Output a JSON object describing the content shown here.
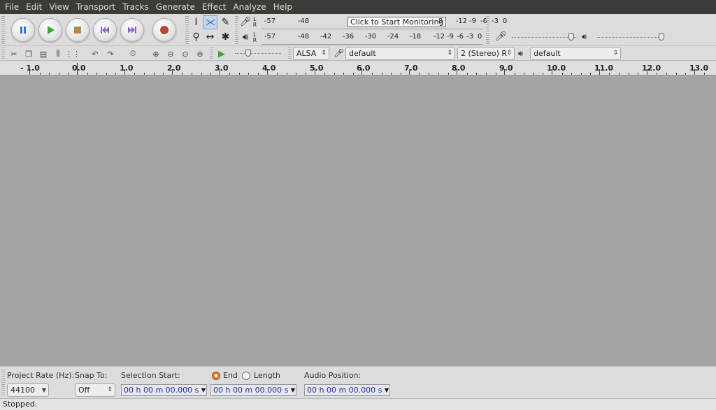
{
  "menu": [
    "File",
    "Edit",
    "View",
    "Transport",
    "Tracks",
    "Generate",
    "Effect",
    "Analyze",
    "Help"
  ],
  "transport": {
    "buttons": [
      {
        "name": "pause-button",
        "icon": "pause-icon",
        "color": "#3b6fd0"
      },
      {
        "name": "play-button",
        "icon": "play-icon",
        "color": "#3fa53a"
      },
      {
        "name": "stop-button",
        "icon": "stop-icon",
        "color": "#b58552"
      },
      {
        "name": "skip-to-start-button",
        "icon": "skip-start-icon",
        "color": "#8a63c5"
      },
      {
        "name": "skip-to-end-button",
        "icon": "skip-end-icon",
        "color": "#8a63c5"
      },
      {
        "name": "record-button",
        "icon": "record-icon",
        "color": "#b5483a"
      }
    ]
  },
  "meters": {
    "record_ticks": [
      "-57",
      "-48",
      "8",
      "-12",
      "-9",
      "-6",
      "-3",
      "0"
    ],
    "playback_ticks": [
      "-57",
      "-48",
      "-42",
      "-36",
      "-30",
      "-24",
      "-18",
      "-12",
      "-9",
      "-6",
      "-3",
      "0"
    ],
    "monitor_tooltip": "Click to Start Monitoring",
    "lr_labels": [
      "L",
      "R"
    ]
  },
  "mixer": {
    "recording_volume": 0.9,
    "playback_volume": 1.0
  },
  "device": {
    "host": "ALSA",
    "recording_device": "default",
    "channels": "2 (Stereo) R",
    "playback_device": "default"
  },
  "ruler": {
    "labels": [
      "- 1.0",
      "0.0",
      "1.0",
      "2.0",
      "3.0",
      "4.0",
      "5.0",
      "6.0",
      "7.0",
      "8.0",
      "9.0",
      "10.0",
      "11.0",
      "12.0",
      "13.0"
    ]
  },
  "selection_bar": {
    "project_rate_label": "Project Rate (Hz):",
    "project_rate_value": "44100",
    "snap_to_label": "Snap To:",
    "snap_to_value": "Off",
    "selection_start_label": "Selection Start:",
    "end_label": "End",
    "length_label": "Length",
    "audio_position_label": "Audio Position:",
    "selection_start_value": "00 h 00 m 00.000 s",
    "selection_end_value": "00 h 00 m 00.000 s",
    "audio_position_value": "00 h 00 m 00.000 s"
  },
  "status": "Stopped."
}
